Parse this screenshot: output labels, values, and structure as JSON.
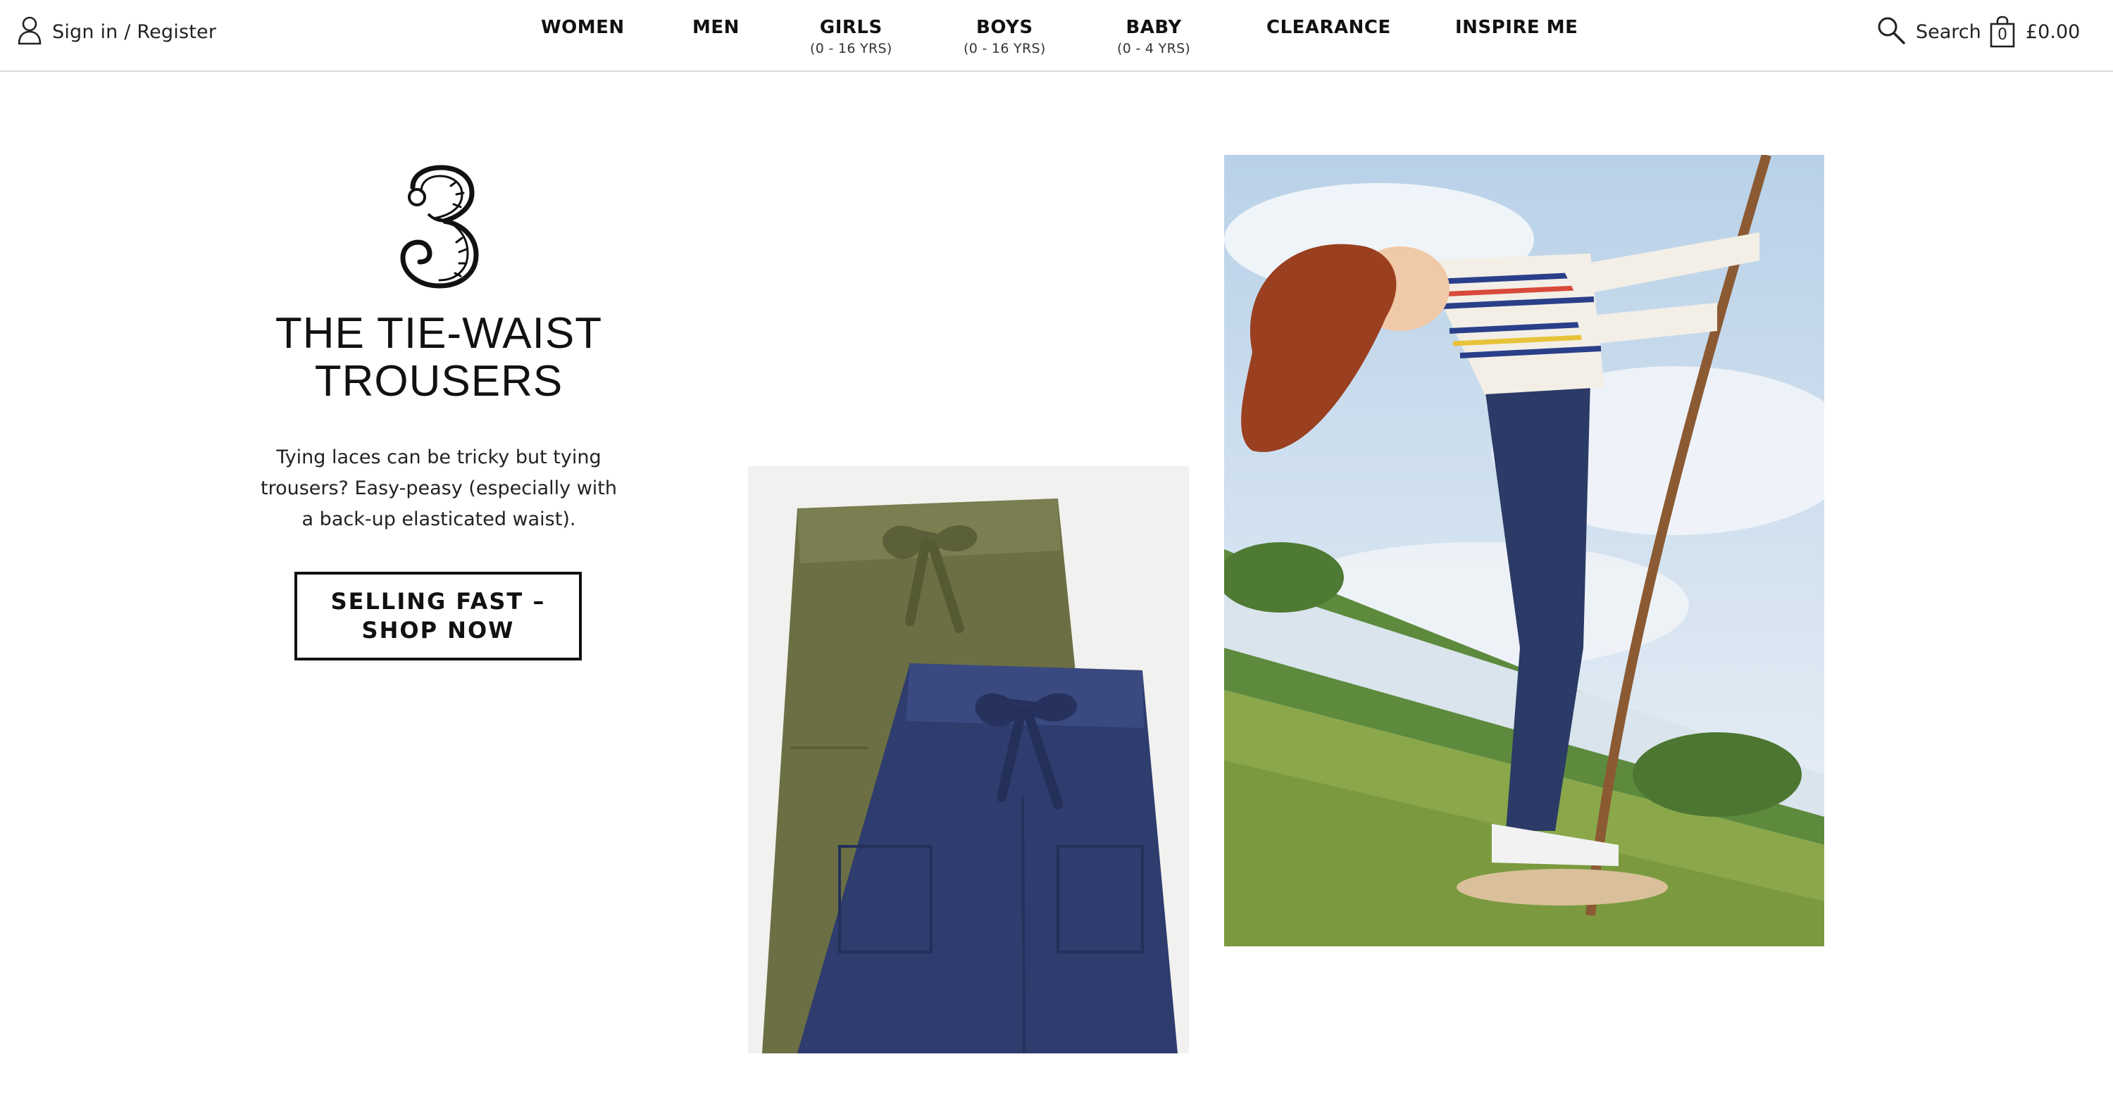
{
  "header": {
    "signin_label": "Sign in / Register",
    "nav": [
      {
        "label": "WOMEN",
        "sub": ""
      },
      {
        "label": "MEN",
        "sub": ""
      },
      {
        "label": "GIRLS",
        "sub": "(0 - 16 YRS)"
      },
      {
        "label": "BOYS",
        "sub": "(0 - 16 YRS)"
      },
      {
        "label": "BABY",
        "sub": "(0 - 4 YRS)"
      },
      {
        "label": "CLEARANCE",
        "sub": ""
      },
      {
        "label": "INSPIRE ME",
        "sub": ""
      }
    ],
    "search_label": "Search",
    "basket_count": "0",
    "basket_total": "£0.00"
  },
  "feature": {
    "numeral": "3",
    "title": "THE TIE-WAIST TROUSERS",
    "description": "Tying laces can be tricky but tying trousers? Easy-peasy (especially with a back-up elasticated waist).",
    "cta_label": "SELLING FAST –\nSHOP NOW"
  },
  "icons": {
    "user": "user-icon",
    "search": "search-icon",
    "basket": "shopping-bag-icon"
  },
  "colors": {
    "text": "#111111",
    "divider": "#d9d9d9",
    "olive_trousers": "#6b6f43",
    "navy_trousers": "#2e3c6e",
    "sky": "#cfe0ef",
    "grass": "#8aa84a"
  }
}
